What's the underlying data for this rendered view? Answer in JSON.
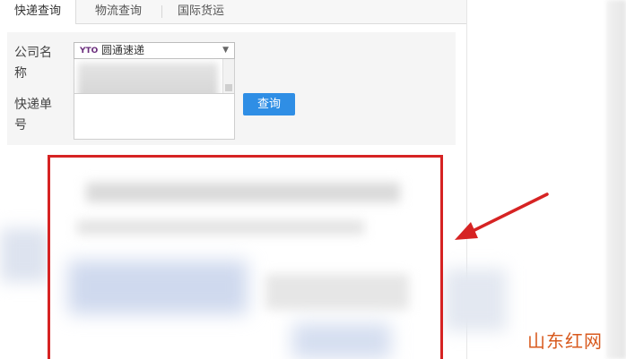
{
  "tabs": [
    {
      "label": "快递查询",
      "active": true
    },
    {
      "label": "物流查询",
      "active": false
    },
    {
      "label": "国际货运",
      "active": false
    }
  ],
  "form": {
    "company_label": "公司名称",
    "company_selected": "圆通速递",
    "company_logo_text": "YTO",
    "tracking_label": "快递单号",
    "query_button": "查询"
  },
  "watermark": "山东红网",
  "colors": {
    "highlight_frame": "#d62323",
    "button": "#2f8ee5",
    "watermark": "#d85a1e"
  }
}
